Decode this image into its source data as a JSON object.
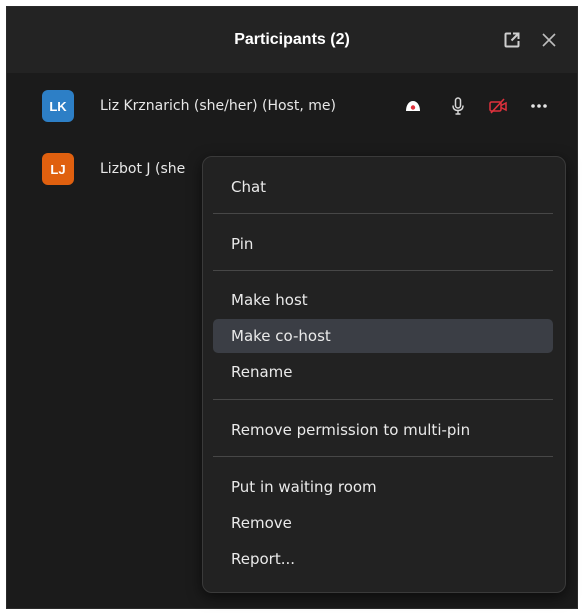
{
  "header": {
    "title": "Participants (2)"
  },
  "participants": [
    {
      "initials": "LK",
      "name": "Liz Krznarich (she/her) (Host, me)",
      "avatar_color": "#2d7fc6"
    },
    {
      "initials": "LJ",
      "name": "Lizbot J (she",
      "avatar_color": "#e0600f"
    }
  ],
  "menu": {
    "chat": "Chat",
    "pin": "Pin",
    "make_host": "Make host",
    "make_cohost": "Make co-host",
    "rename": "Rename",
    "remove_multipin": "Remove permission to multi-pin",
    "waiting_room": "Put in waiting room",
    "remove": "Remove",
    "report": "Report..."
  },
  "colors": {
    "panel_bg": "#1b1b1b",
    "header_bg": "#232323",
    "menu_bg": "#222222",
    "highlight": "#3b3e45",
    "video_off_red": "#e0313c"
  },
  "icons": [
    "popout-icon",
    "close-icon",
    "host-icon",
    "microphone-icon",
    "video-off-icon",
    "more-icon"
  ]
}
